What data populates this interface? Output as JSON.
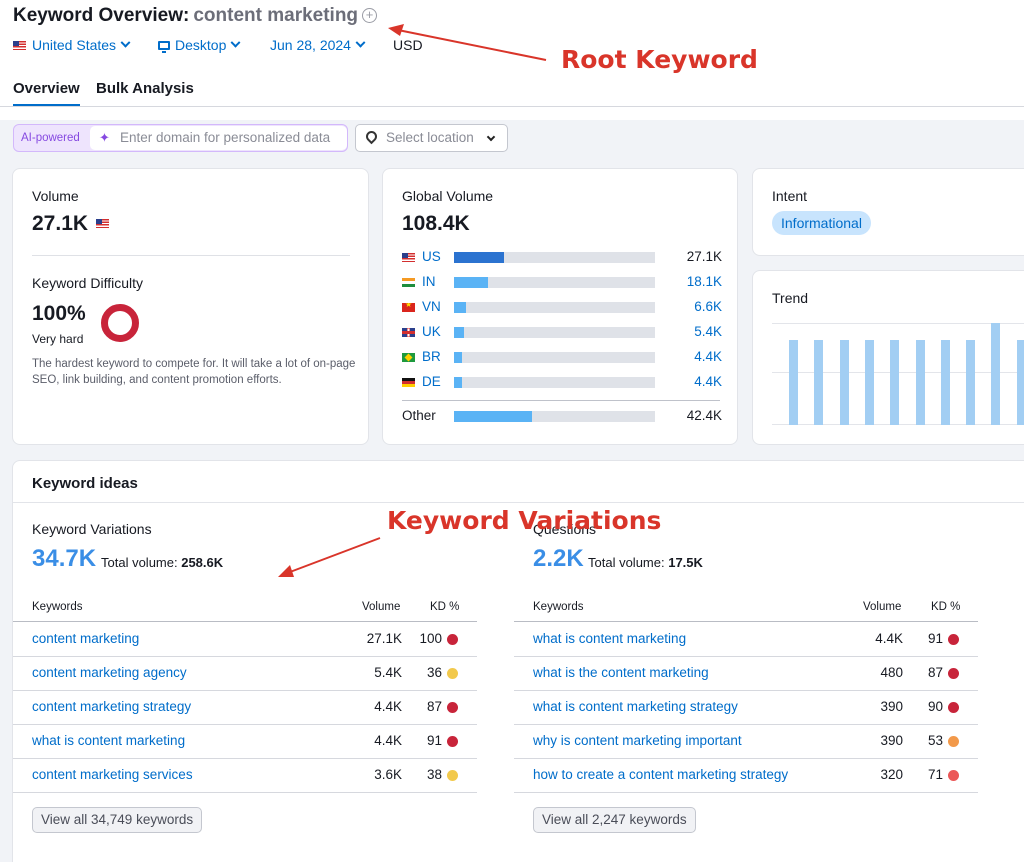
{
  "header": {
    "title_prefix": "Keyword Overview:",
    "keyword": "content marketing",
    "add_icon": "plus-circle-icon",
    "filters": {
      "country": "United States",
      "device": "Desktop",
      "date": "Jun 28, 2024",
      "currency": "USD"
    },
    "tabs": [
      {
        "label": "Overview",
        "active": true
      },
      {
        "label": "Bulk Analysis",
        "active": false
      }
    ]
  },
  "toolbar": {
    "ai_label": "AI-powered",
    "domain_placeholder": "Enter domain for personalized data",
    "location_placeholder": "Select location"
  },
  "volume": {
    "label": "Volume",
    "value": "27.1K",
    "kd_label": "Keyword Difficulty",
    "kd_value": "100%",
    "kd_level": "Very hard",
    "kd_description": "The hardest keyword to compete for. It will take a lot of on-page SEO, link building, and content promotion efforts."
  },
  "global_volume": {
    "label": "Global Volume",
    "value": "108.4K",
    "countries": [
      {
        "code": "US",
        "value": "27.1K",
        "share": 0.25
      },
      {
        "code": "IN",
        "value": "18.1K",
        "share": 0.17
      },
      {
        "code": "VN",
        "value": "6.6K",
        "share": 0.06
      },
      {
        "code": "UK",
        "value": "5.4K",
        "share": 0.05
      },
      {
        "code": "BR",
        "value": "4.4K",
        "share": 0.04
      },
      {
        "code": "DE",
        "value": "4.4K",
        "share": 0.04
      }
    ],
    "other_label": "Other",
    "other_value": "42.4K",
    "other_share": 0.39
  },
  "intent": {
    "label": "Intent",
    "value": "Informational"
  },
  "trend": {
    "label": "Trend",
    "values": [
      0.83,
      0.83,
      0.83,
      0.83,
      0.83,
      0.83,
      0.83,
      0.83,
      1.0,
      0.83
    ]
  },
  "ideas": {
    "title": "Keyword ideas",
    "variations": {
      "label": "Keyword Variations",
      "count": "34.7K",
      "total_label": "Total volume:",
      "total": "258.6K",
      "columns": [
        "Keywords",
        "Volume",
        "KD %"
      ],
      "rows": [
        {
          "keyword": "content marketing",
          "volume": "27.1K",
          "kd": "100",
          "color": "#c8243a"
        },
        {
          "keyword": "content marketing agency",
          "volume": "5.4K",
          "kd": "36",
          "color": "#f2c94c"
        },
        {
          "keyword": "content marketing strategy",
          "volume": "4.4K",
          "kd": "87",
          "color": "#c8243a"
        },
        {
          "keyword": "what is content marketing",
          "volume": "4.4K",
          "kd": "91",
          "color": "#c8243a"
        },
        {
          "keyword": "content marketing services",
          "volume": "3.6K",
          "kd": "38",
          "color": "#f2c94c"
        }
      ],
      "view_all": "View all 34,749 keywords"
    },
    "questions": {
      "label": "Questions",
      "count": "2.2K",
      "total_label": "Total volume:",
      "total": "17.5K",
      "columns": [
        "Keywords",
        "Volume",
        "KD %"
      ],
      "rows": [
        {
          "keyword": "what is content marketing",
          "volume": "4.4K",
          "kd": "91",
          "color": "#c8243a"
        },
        {
          "keyword": "what is the content marketing",
          "volume": "480",
          "kd": "87",
          "color": "#c8243a"
        },
        {
          "keyword": "what is content marketing strategy",
          "volume": "390",
          "kd": "90",
          "color": "#c8243a"
        },
        {
          "keyword": "why is content marketing important",
          "volume": "390",
          "kd": "53",
          "color": "#f2994a"
        },
        {
          "keyword": "how to create a content marketing strategy",
          "volume": "320",
          "kd": "71",
          "color": "#eb5757"
        }
      ],
      "view_all": "View all 2,247 keywords"
    }
  },
  "annotations": {
    "root": "Root Keyword",
    "variations": "Keyword Variations",
    "color": "#d9352a"
  }
}
